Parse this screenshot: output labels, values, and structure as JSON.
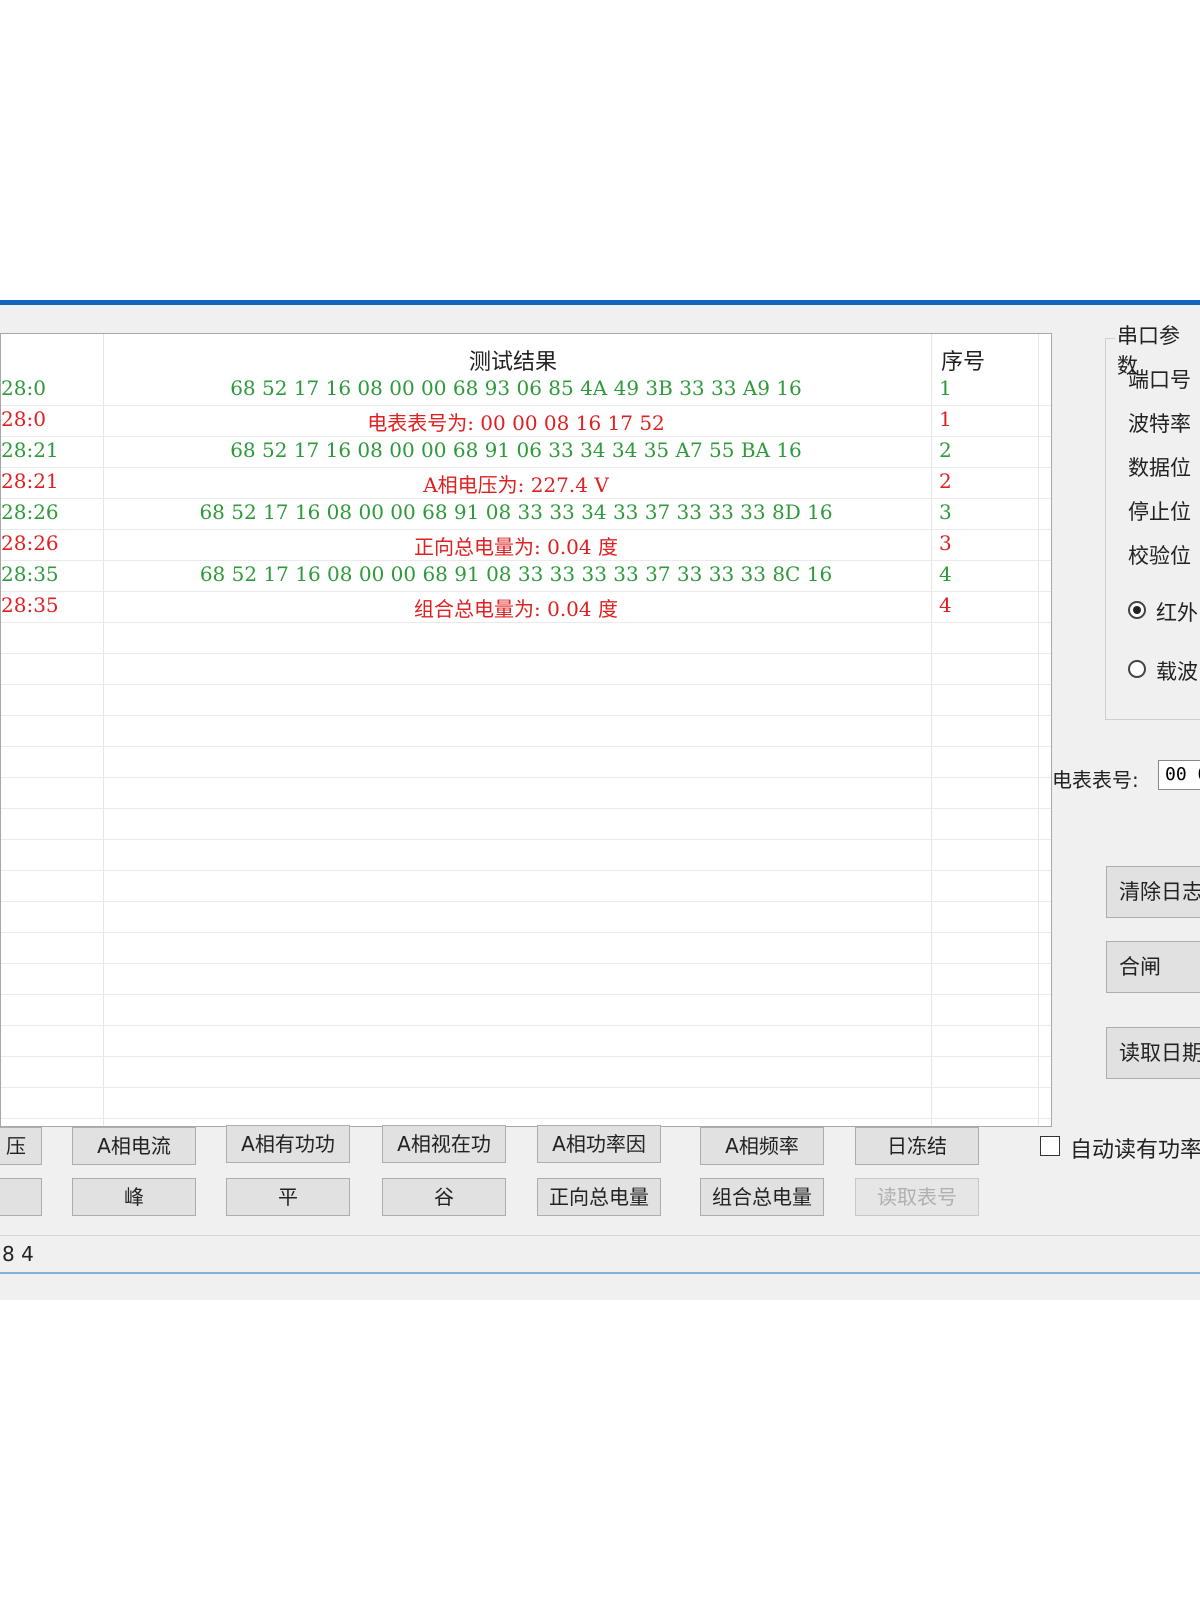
{
  "grid": {
    "headers": {
      "result": "测试结果",
      "seq": "序号"
    },
    "rows": [
      {
        "time": "28:0",
        "result": "68 52 17 16 08 00 00 68 93 06 85 4A 49 3B 33 33 A9 16",
        "seq": "1",
        "color": "green"
      },
      {
        "time": "28:0",
        "result": "电表表号为: 00 00 08 16 17 52",
        "seq": "1",
        "color": "red"
      },
      {
        "time": "28:21",
        "result": "68 52 17 16 08 00 00 68 91 06 33 34 34 35 A7 55 BA 16",
        "seq": "2",
        "color": "green"
      },
      {
        "time": "28:21",
        "result": "A相电压为: 227.4 V",
        "seq": "2",
        "color": "red"
      },
      {
        "time": "28:26",
        "result": "68 52 17 16 08 00 00 68 91 08 33 33 34 33 37 33 33 33 8D 16",
        "seq": "3",
        "color": "green"
      },
      {
        "time": "28:26",
        "result": "正向总电量为: 0.04 度",
        "seq": "3",
        "color": "red"
      },
      {
        "time": "28:35",
        "result": "68 52 17 16 08 00 00 68 91 08 33 33 33 33 37 33 33 33 8C 16",
        "seq": "4",
        "color": "green"
      },
      {
        "time": "28:35",
        "result": "组合总电量为: 0.04 度",
        "seq": "4",
        "color": "red"
      }
    ],
    "colors": {
      "green": "#2e9a3a",
      "red": "#e02020"
    }
  },
  "serial": {
    "group_title": "串口参数",
    "labels": [
      "端口号",
      "波特率",
      "数据位",
      "停止位",
      "校验位"
    ],
    "radio_infrared": "红外",
    "radio_carrier": "载波",
    "selected": "红外"
  },
  "meter": {
    "label": "电表表号:",
    "value": "00 0"
  },
  "side_buttons": {
    "clear_log": "清除日志",
    "close_switch": "合闸",
    "read_date": "读取日期"
  },
  "buttons_row1": {
    "voltage": "压",
    "a_current": "A相电流",
    "a_active_power": "A相有功功",
    "a_apparent_power": "A相视在功",
    "a_power_factor": "A相功率因",
    "a_frequency": "A相频率",
    "daily_freeze": "日冻结"
  },
  "buttons_row2": {
    "blank": "",
    "peak": "峰",
    "flat": "平",
    "valley": "谷",
    "forward_total": "正向总电量",
    "combined_total": "组合总电量",
    "read_meter_no": "读取表号"
  },
  "auto_read": {
    "label": "自动读有功率"
  },
  "status": {
    "text": "8 4"
  }
}
